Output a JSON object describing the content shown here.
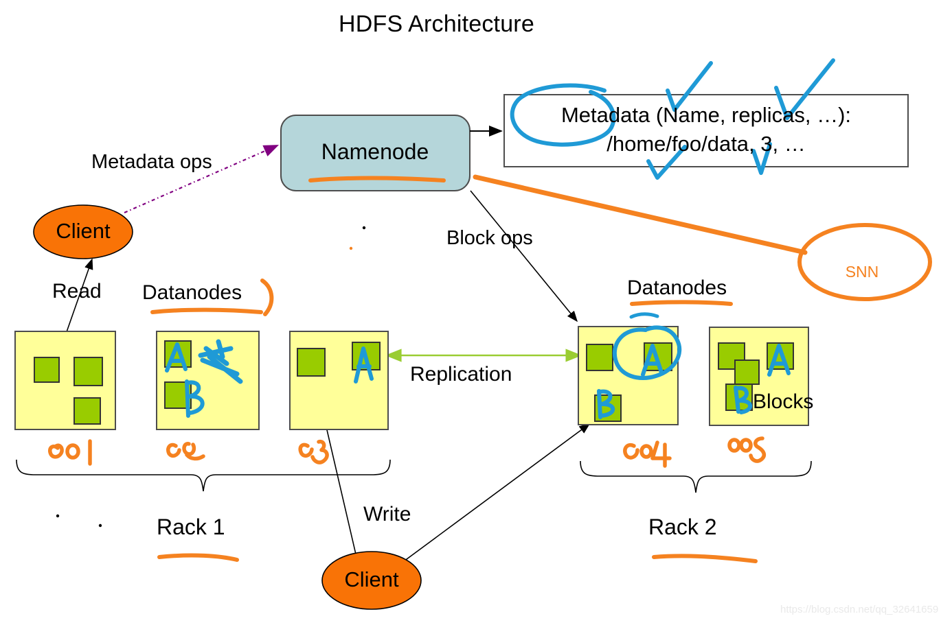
{
  "title": "HDFS Architecture",
  "nodes": {
    "namenode": {
      "label": "Namenode"
    },
    "metadata_box": {
      "line1": "Metadata (Name, replicas, …):",
      "line2": "/home/foo/data, 3, …"
    },
    "client_top": {
      "label": "Client"
    },
    "client_bottom": {
      "label": "Client"
    },
    "snn": {
      "label": "SNN"
    }
  },
  "labels": {
    "metadata_ops": "Metadata ops",
    "block_ops": "Block ops",
    "read": "Read",
    "write": "Write",
    "replication": "Replication",
    "datanodes_left": "Datanodes",
    "datanodes_right": "Datanodes",
    "blocks": "Blocks",
    "rack1": "Rack 1",
    "rack2": "Rack 2"
  },
  "annotations": {
    "handwritten_node_ids": [
      "001",
      "002",
      "003",
      "004",
      "005"
    ],
    "handwritten_block_letters": [
      "A",
      "B",
      "A",
      "A",
      "B",
      "A",
      "B"
    ],
    "underlines": [
      "Namenode",
      "Datanodes (left)",
      "Datanodes (right)",
      "Rack 1",
      "Rack 2"
    ],
    "checkmarks": 4,
    "circled": [
      "Metadata",
      "block A in node 004"
    ],
    "struck_through": [
      "A in node 002"
    ]
  },
  "racks": {
    "rack1": {
      "name": "Rack 1",
      "datanodes": [
        {
          "id": "001",
          "blocks": [
            {
              "letter": ""
            },
            {
              "letter": ""
            },
            {
              "letter": ""
            }
          ]
        },
        {
          "id": "002",
          "blocks": [
            {
              "letter": "A"
            },
            {
              "letter": "B"
            }
          ]
        },
        {
          "id": "003",
          "blocks": [
            {
              "letter": ""
            },
            {
              "letter": "A"
            }
          ]
        }
      ]
    },
    "rack2": {
      "name": "Rack 2",
      "datanodes": [
        {
          "id": "004",
          "blocks": [
            {
              "letter": ""
            },
            {
              "letter": "A"
            },
            {
              "letter": "B"
            }
          ]
        },
        {
          "id": "005",
          "blocks": [
            {
              "letter": ""
            },
            {
              "letter": ""
            },
            {
              "letter": "A"
            },
            {
              "letter": "B"
            }
          ]
        }
      ]
    }
  },
  "colors": {
    "namenode_fill": "#b5d6da",
    "datanode_fill": "#ffff99",
    "block_fill": "#99cc00",
    "client_fill": "#f97306",
    "annotation_orange": "#f58220",
    "annotation_blue": "#1f9ad6",
    "replication_arrow": "#9acd32",
    "metadata_ops_arrow": "#800080"
  },
  "watermark": "https://blog.csdn.net/qq_32641659"
}
